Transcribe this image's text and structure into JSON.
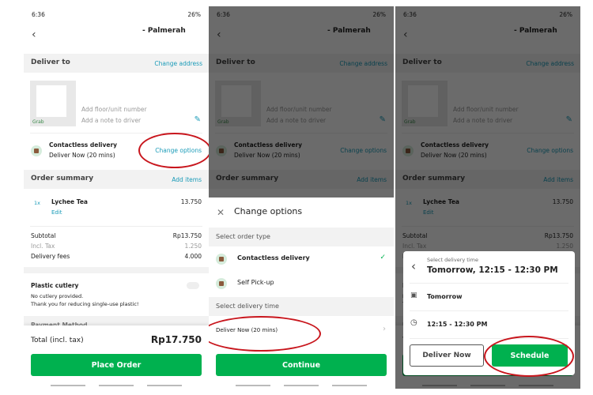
{
  "status": {
    "time": "6:36",
    "battery": "26%"
  },
  "header": {
    "title": "- Palmerah",
    "back_icon": "chevron-left-icon"
  },
  "deliver_to": {
    "heading": "Deliver to",
    "change_address": "Change address",
    "map_label": "Grab",
    "floor_placeholder": "Add floor/unit number",
    "note_placeholder": "Add a note to driver"
  },
  "delivery_option": {
    "type": "Contactless delivery",
    "time": "Deliver Now (20 mins)",
    "change_options": "Change options"
  },
  "order_summary": {
    "heading": "Order summary",
    "add_items": "Add items",
    "items": [
      {
        "qty": "1x",
        "name": "Lychee Tea",
        "edit": "Edit",
        "price": "13.750"
      }
    ],
    "subtotal_label": "Subtotal",
    "subtotal": "Rp13.750",
    "tax_label": "Incl. Tax",
    "tax": "1.250",
    "fees_label": "Delivery fees",
    "fees": "4.000"
  },
  "cutlery": {
    "title": "Plastic cutlery",
    "line1": "No cutlery provided.",
    "line2": "Thank you for reducing single-use plastic!",
    "enabled": false
  },
  "payment": {
    "heading": "Payment Method"
  },
  "footer": {
    "total_label": "Total (incl. tax)",
    "total": "Rp17.750",
    "place_order": "Place Order"
  },
  "change_sheet": {
    "title": "Change options",
    "order_type_heading": "Select order type",
    "order_types": [
      "Contactless delivery",
      "Self Pick-up"
    ],
    "selected": "Contactless delivery",
    "time_heading": "Select delivery time",
    "time_value": "Deliver Now (20 mins)",
    "continue": "Continue"
  },
  "schedule_dialog": {
    "label": "Select delivery time",
    "title": "Tomorrow, 12:15 - 12:30 PM",
    "day": "Tomorrow",
    "slot": "12:15 - 12:30 PM",
    "deliver_now": "Deliver Now",
    "schedule": "Schedule"
  },
  "colors": {
    "accent": "#00b14f",
    "link": "#1a9bb8",
    "annotation": "#c8161d"
  }
}
